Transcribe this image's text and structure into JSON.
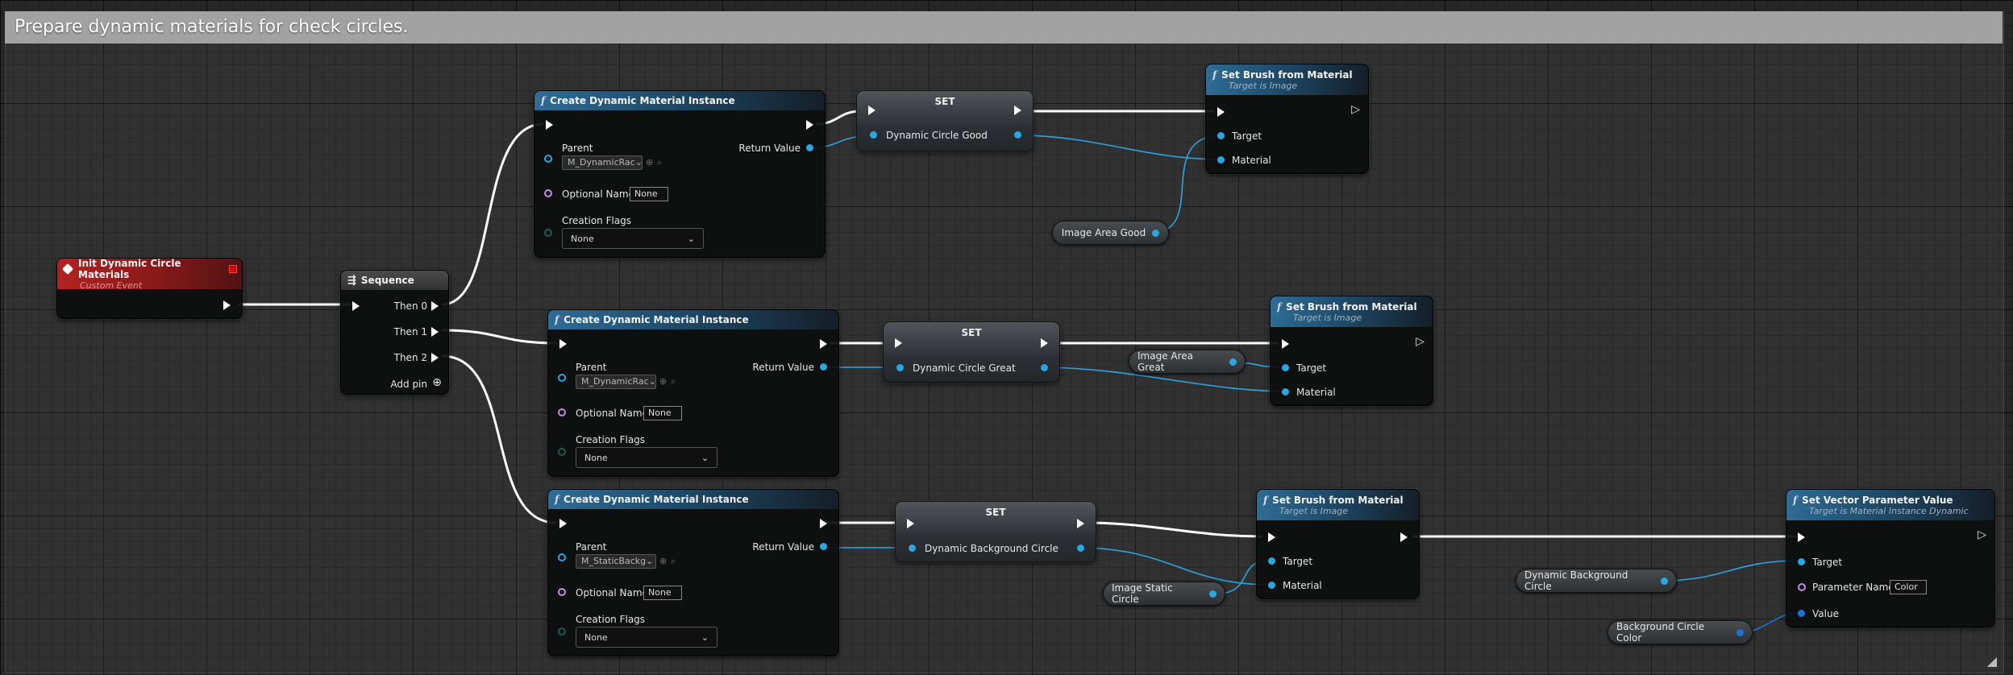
{
  "comment": {
    "title": "Prepare dynamic materials for check circles."
  },
  "event": {
    "title": "Init Dynamic Circle Materials",
    "subtitle": "Custom Event"
  },
  "sequence": {
    "title": "Sequence",
    "then0": "Then 0",
    "then1": "Then 1",
    "then2": "Then 2",
    "add_pin": "Add pin"
  },
  "cdmi": [
    {
      "title": "Create Dynamic Material Instance",
      "parent_label": "Parent",
      "parent_value": "M_DynamicRac",
      "return_label": "Return Value",
      "optional_label": "Optional Name",
      "optional_value": "None",
      "flags_label": "Creation Flags",
      "flags_value": "None"
    },
    {
      "title": "Create Dynamic Material Instance",
      "parent_label": "Parent",
      "parent_value": "M_DynamicRac",
      "return_label": "Return Value",
      "optional_label": "Optional Name",
      "optional_value": "None",
      "flags_label": "Creation Flags",
      "flags_value": "None"
    },
    {
      "title": "Create Dynamic Material Instance",
      "parent_label": "Parent",
      "parent_value": "M_StaticBackg",
      "return_label": "Return Value",
      "optional_label": "Optional Name",
      "optional_value": "None",
      "flags_label": "Creation Flags",
      "flags_value": "None"
    }
  ],
  "sets": [
    {
      "title": "SET",
      "var": "Dynamic Circle Good"
    },
    {
      "title": "SET",
      "var": "Dynamic Circle Great"
    },
    {
      "title": "SET",
      "var": "Dynamic Background Circle"
    }
  ],
  "brush": [
    {
      "title": "Set Brush from Material",
      "subtitle": "Target is Image",
      "target": "Target",
      "material": "Material"
    },
    {
      "title": "Set Brush from Material",
      "subtitle": "Target is Image",
      "target": "Target",
      "material": "Material"
    },
    {
      "title": "Set Brush from Material",
      "subtitle": "Target is Image",
      "target": "Target",
      "material": "Material"
    }
  ],
  "vars": {
    "image_good": "Image Area Good",
    "image_great": "Image Area Great",
    "image_static": "Image Static Circle",
    "dyn_bg": "Dynamic Background Circle",
    "bg_color": "Background Circle Color"
  },
  "vector": {
    "title": "Set Vector Parameter Value",
    "subtitle": "Target is Material Instance Dynamic",
    "target": "Target",
    "param_label": "Parameter Name",
    "param_value": "Color",
    "value_label": "Value"
  },
  "colors": {
    "exec": "#ffffff",
    "object_pin": "#2aa6e3",
    "struct_pin": "#1e6fd9",
    "function_header": "#2f6c95",
    "event_header": "#b32222",
    "comment_bar": "#a2a2a2"
  },
  "icons": {
    "function": "function-icon",
    "event": "event-diamond-icon",
    "sequence": "sequence-icon",
    "add": "add-pin-icon",
    "dropdown": "chevron-down-icon",
    "resize": "resize-grip-icon"
  }
}
